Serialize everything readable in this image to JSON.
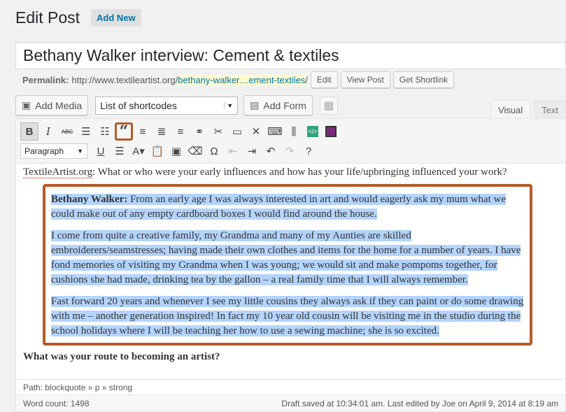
{
  "header": {
    "title": "Edit Post",
    "add_new": "Add New"
  },
  "post": {
    "title": "Bethany Walker interview: Cement & textiles"
  },
  "permalink": {
    "label": "Permalink:",
    "base": "http://www.textileartist.org/",
    "slug": "bethany-walker…ement-textiles",
    "suffix": "/",
    "edit": "Edit",
    "view_post": "View Post",
    "get_shortlink": "Get Shortlink"
  },
  "media": {
    "add_media": "Add Media",
    "shortcodes": "List of shortcodes",
    "add_form": "Add Form"
  },
  "tabs": {
    "visual": "Visual",
    "text": "Text"
  },
  "toolbar": {
    "row1": [
      "bold-button",
      "italic-button",
      "strikethrough-button",
      "bullet-list-button",
      "numbered-list-button",
      "blockquote-button",
      "align-left-button",
      "align-center-button",
      "align-right-button",
      "insert-link-button",
      "remove-link-button",
      "read-more-button",
      "fullscreen-button",
      "keyboard-button",
      "columns-button",
      "code-button",
      "grid-button"
    ],
    "format": "Paragraph"
  },
  "content": {
    "question_site": "TextileArtist.org",
    "question_rest": ": What or who were your early influences and how has your life/upbringing influenced your work?",
    "answer_name": "Bethany Walker:",
    "p1": " From an early age I was always interested in art and would eagerly ask my mum what we could make out of any empty cardboard boxes I would find around the house.",
    "p2": "I come from quite a creative family, my Grandma and many of my Aunties are skilled embroiderers/seamstresses; having made their own clothes and items for the home for a number of years. I have fond memories of visiting my Grandma when I was young; we would sit and make pompoms together, for cushions she had made, drinking tea by the gallon – a real family time that I will always remember.",
    "p3": "Fast forward 20 years and whenever I see my little cousins they always ask if they can paint or do some drawing with me – another generation inspired! In fact my 10 year old cousin will be visiting me in the studio during the school holidays where I will be teaching her how to use a sewing machine; she is so excited.",
    "next_question": "What was your route to becoming an artist?"
  },
  "path": "Path: blockquote » p » strong",
  "status": {
    "word_count": "Word count: 1498",
    "saved": "Draft saved at 10:34:01 am. Last edited by Joe on April 9, 2014 at 8:19 am"
  }
}
